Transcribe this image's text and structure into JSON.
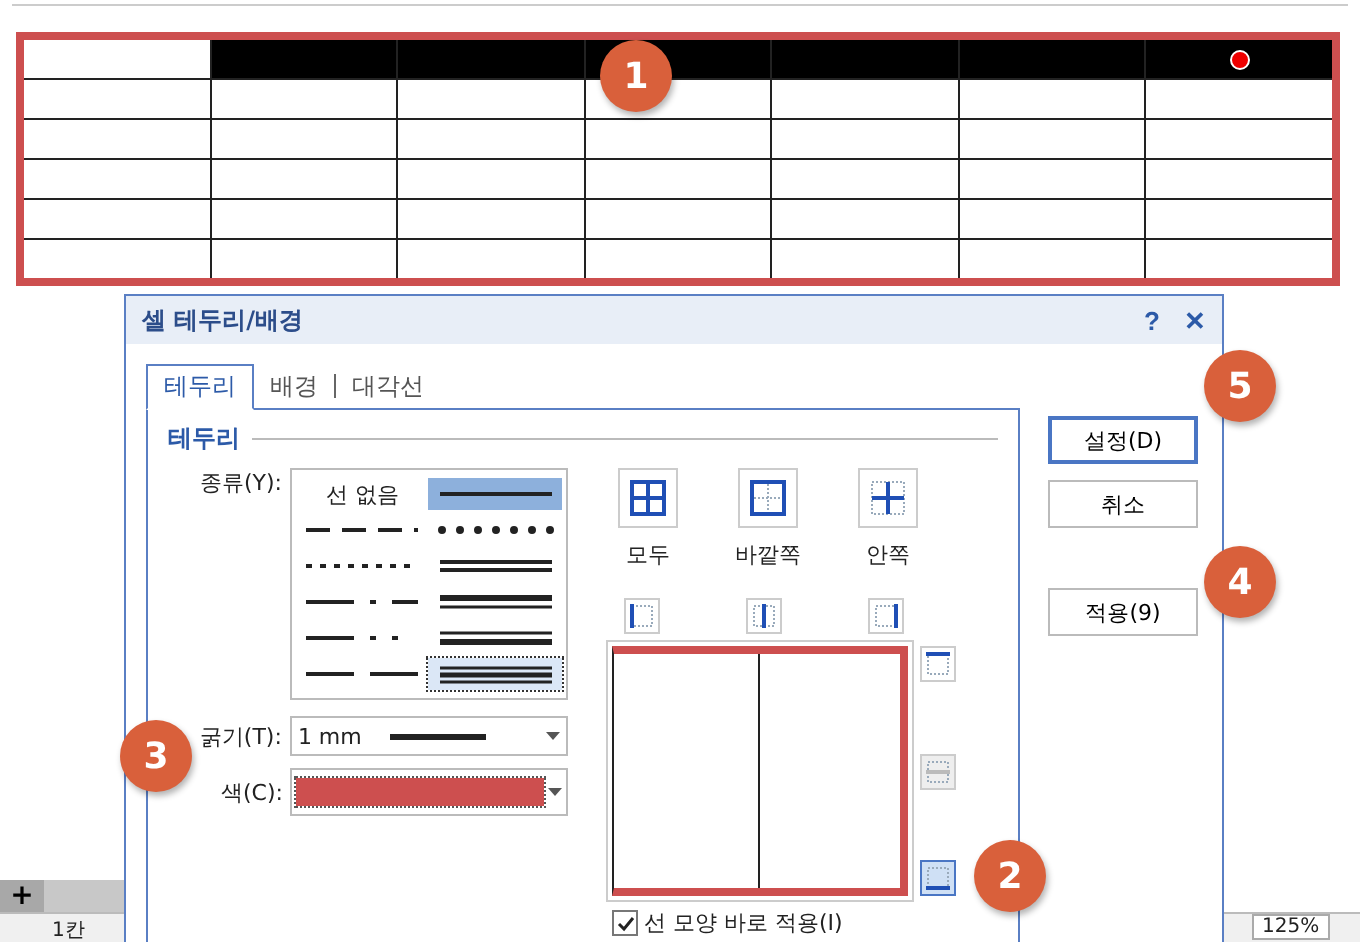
{
  "document_table": {
    "selected": true,
    "header_filled": true,
    "marker": true
  },
  "dialog": {
    "title": "셀 테두리/배경",
    "help": "?",
    "close": "✕",
    "tabs": [
      {
        "label": "테두리",
        "selected": true
      },
      {
        "label": "배경",
        "selected": false
      },
      {
        "label": "대각선",
        "selected": false
      }
    ],
    "group_title": "테두리",
    "type_label": "종류(Y):",
    "line_styles": [
      {
        "kind": "none",
        "label": "선 없음",
        "selected": false,
        "focused": false
      },
      {
        "kind": "solid",
        "selected": true,
        "focused": false
      },
      {
        "kind": "dash",
        "selected": false,
        "focused": false
      },
      {
        "kind": "round-dots",
        "selected": false,
        "focused": false
      },
      {
        "kind": "dotted",
        "selected": false,
        "focused": false
      },
      {
        "kind": "double",
        "selected": false,
        "focused": false
      },
      {
        "kind": "dash-dot",
        "selected": false,
        "focused": false
      },
      {
        "kind": "thick-thin",
        "selected": false,
        "focused": false
      },
      {
        "kind": "dash-dot-dot",
        "selected": false,
        "focused": false
      },
      {
        "kind": "thin-thick",
        "selected": false,
        "focused": false
      },
      {
        "kind": "long-dash",
        "selected": false,
        "focused": false
      },
      {
        "kind": "triple",
        "selected": false,
        "focused": true
      }
    ],
    "thickness_label": "굵기(T):",
    "thickness_value": "1 mm",
    "color_label": "색(C):",
    "color": "#cd4f4f",
    "presets": [
      {
        "kind": "all",
        "label": "모두"
      },
      {
        "kind": "outside",
        "label": "바깥쪽"
      },
      {
        "kind": "inside",
        "label": "안쪽"
      }
    ],
    "vertical_buttons": [
      {
        "kind": "left",
        "on": false,
        "disabled": false
      },
      {
        "kind": "center",
        "on": false,
        "disabled": false
      },
      {
        "kind": "right",
        "on": false,
        "disabled": false
      }
    ],
    "horizontal_buttons": [
      {
        "kind": "top",
        "on": false,
        "disabled": false
      },
      {
        "kind": "middle",
        "on": false,
        "disabled": true
      },
      {
        "kind": "bottom",
        "on": true,
        "disabled": false
      }
    ],
    "apply_immediately": {
      "label": "선 모양 바로 적용(I)",
      "checked": true
    },
    "buttons": [
      {
        "label": "설정(D)",
        "default": true
      },
      {
        "label": "취소",
        "default": false
      },
      {
        "label": "적용(9)",
        "default": false
      }
    ]
  },
  "sheet_tab_add": "+",
  "status_bar": {
    "left": "1칸",
    "zoom": "125%"
  },
  "callouts": [
    "1",
    "2",
    "3",
    "4",
    "5"
  ]
}
